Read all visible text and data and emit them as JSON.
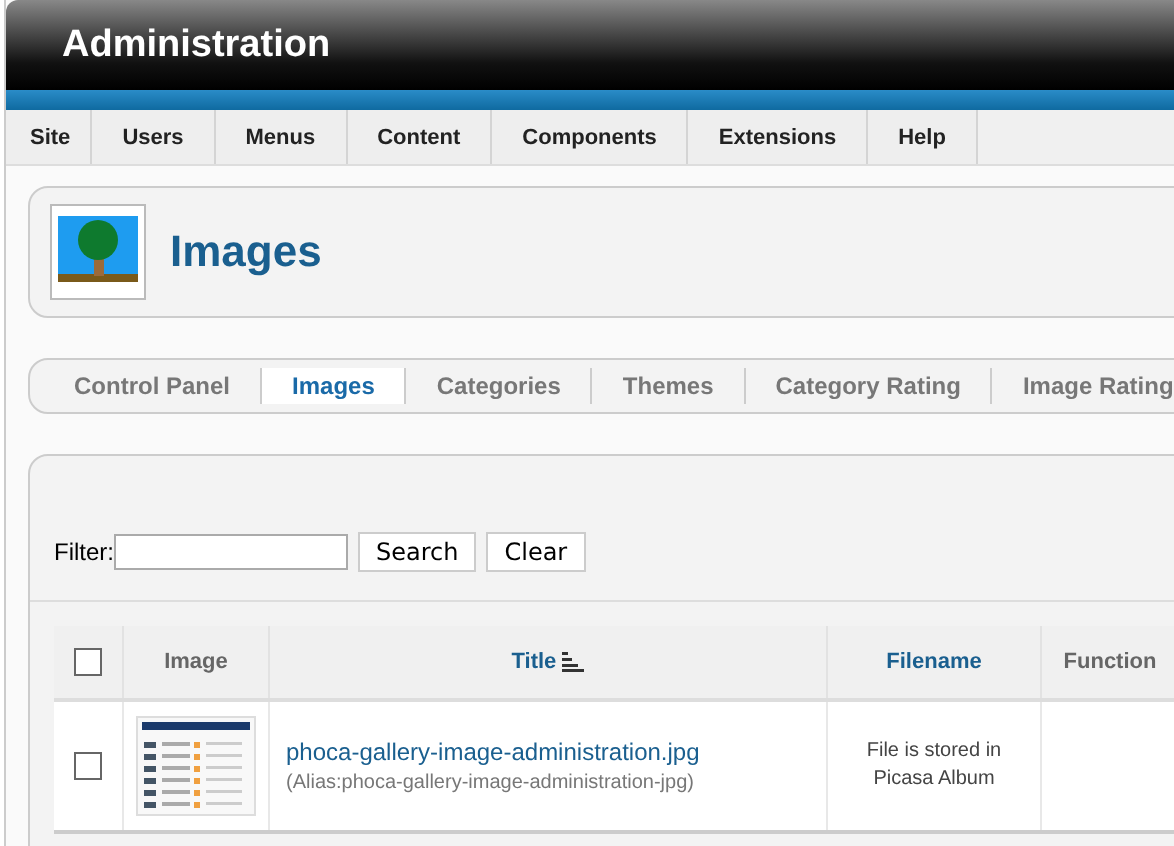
{
  "header": {
    "title": "Administration"
  },
  "menu": [
    {
      "label": "Site"
    },
    {
      "label": "Users"
    },
    {
      "label": "Menus"
    },
    {
      "label": "Content"
    },
    {
      "label": "Components"
    },
    {
      "label": "Extensions"
    },
    {
      "label": "Help"
    }
  ],
  "toolbar": {
    "title": "Images"
  },
  "submenu": [
    {
      "label": "Control Panel",
      "selected": false
    },
    {
      "label": "Images",
      "selected": true
    },
    {
      "label": "Categories",
      "selected": false
    },
    {
      "label": "Themes",
      "selected": false
    },
    {
      "label": "Category Rating",
      "selected": false
    },
    {
      "label": "Image Rating",
      "selected": false
    }
  ],
  "filter": {
    "label": "Filter:",
    "buttons": [
      "Search",
      "Clear"
    ]
  },
  "table": {
    "columns": [
      {
        "kind": "checkbox",
        "checked": false
      },
      {
        "label": "Image",
        "kind": "plain"
      },
      {
        "label": "Title",
        "kind": "sorted"
      },
      {
        "label": "Filename",
        "kind": "link"
      },
      {
        "label": "Function",
        "kind": "plain"
      }
    ],
    "rows": [
      {
        "checked": false,
        "title": "phoca-gallery-image-administration.jpg",
        "alias": "(Alias:phoca-gallery-image-administration-jpg)",
        "filename": "File is stored in Picasa Album"
      }
    ]
  }
}
